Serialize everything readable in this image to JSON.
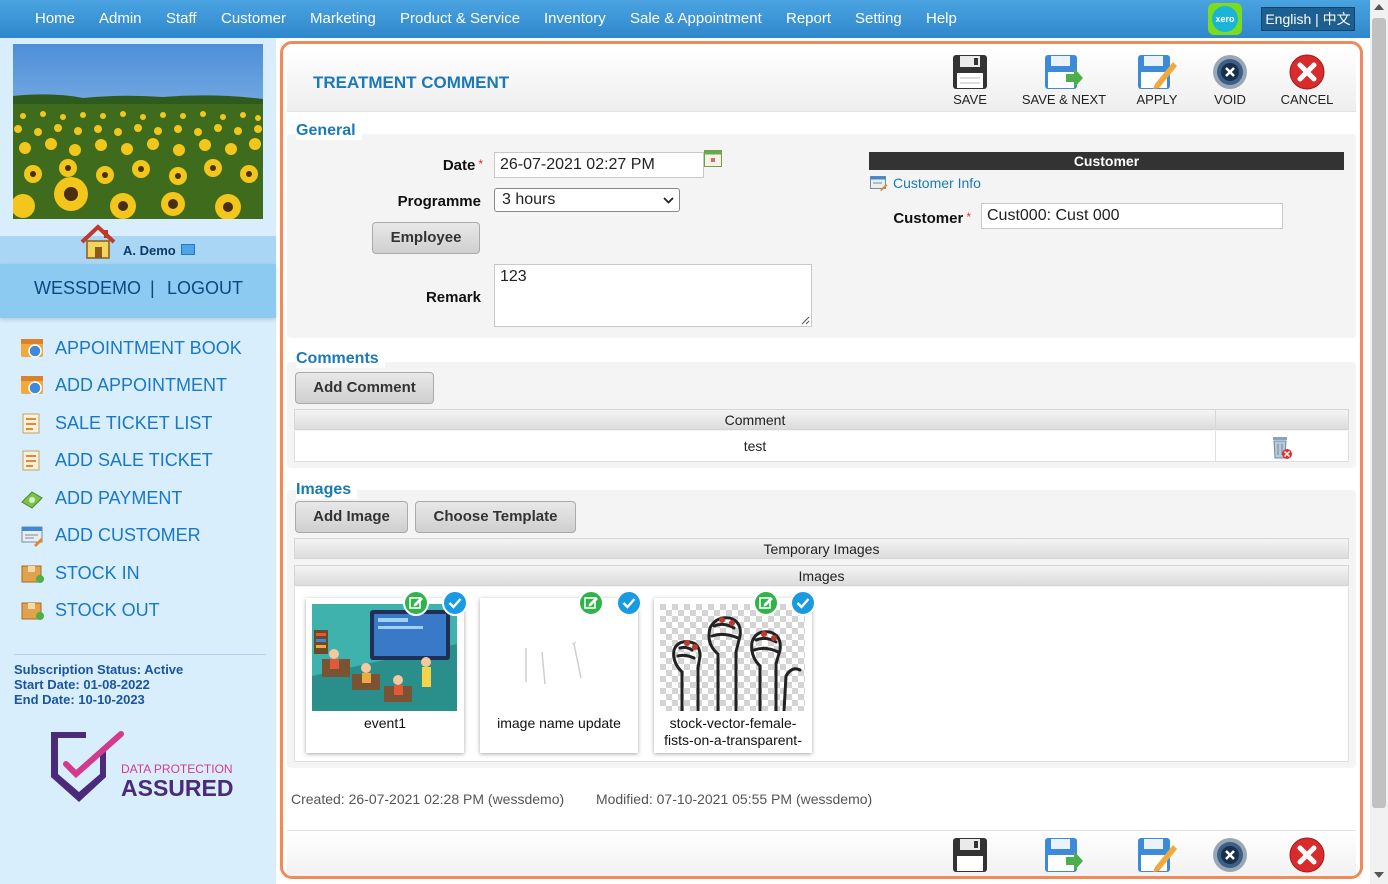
{
  "nav": {
    "items": [
      "Home",
      "Admin",
      "Staff",
      "Customer",
      "Marketing",
      "Product & Service",
      "Inventory",
      "Sale & Appointment",
      "Report",
      "Setting",
      "Help"
    ],
    "xero_label": "xero",
    "language": "English | 中文"
  },
  "sidebar": {
    "user_name": "A. Demo",
    "account": "WESSDEMO",
    "separator": "|",
    "logout": "LOGOUT",
    "menu": [
      {
        "label": "APPOINTMENT BOOK",
        "icon": "appointment-book-icon"
      },
      {
        "label": "ADD APPOINTMENT",
        "icon": "add-appointment-icon"
      },
      {
        "label": "SALE TICKET LIST",
        "icon": "sale-ticket-list-icon"
      },
      {
        "label": "ADD SALE TICKET",
        "icon": "add-sale-ticket-icon"
      },
      {
        "label": "ADD PAYMENT",
        "icon": "add-payment-icon"
      },
      {
        "label": "ADD CUSTOMER",
        "icon": "add-customer-icon"
      },
      {
        "label": "STOCK IN",
        "icon": "stock-in-icon"
      },
      {
        "label": "STOCK OUT",
        "icon": "stock-out-icon"
      }
    ],
    "subscription_status": "Subscription Status: Active",
    "start_date": "Start Date: 01-08-2022",
    "end_date": "End Date: 10-10-2023",
    "badge_line1": "DATA PROTECTION",
    "badge_line2": "ASSURED"
  },
  "form": {
    "title": "TREATMENT COMMENT",
    "toolbar": {
      "save": "SAVE",
      "save_next": "SAVE & NEXT",
      "apply": "APPLY",
      "void": "VOID",
      "cancel": "CANCEL"
    },
    "general": {
      "title": "General",
      "date_label": "Date",
      "required_mark": "*",
      "date_value": "26-07-2021 02:27 PM",
      "programme_label": "Programme",
      "programme_value": "3 hours",
      "employee_button": "Employee",
      "remark_label": "Remark",
      "remark_value": "123"
    },
    "customer": {
      "header": "Customer",
      "info_link": "Customer Info",
      "label": "Customer",
      "value": "Cust000: Cust 000"
    },
    "comments": {
      "title": "Comments",
      "add_button": "Add Comment",
      "column": "Comment",
      "rows": [
        "test"
      ]
    },
    "images": {
      "title": "Images",
      "add_button": "Add Image",
      "template_button": "Choose Template",
      "temp_header": "Temporary Images",
      "images_header": "Images",
      "items": [
        {
          "caption": "event1"
        },
        {
          "caption": "image name update"
        },
        {
          "caption": "stock-vector-female-fists-on-a-transparent-background"
        }
      ]
    },
    "meta": {
      "created": "Created: 26-07-2021 02:28 PM (wessdemo)",
      "modified": "Modified: 07-10-2021 05:55 PM (wessdemo)"
    }
  },
  "colors": {
    "nav_bg": "#2f87cc",
    "sidebar_bg": "#d9eefc",
    "accent_blue": "#1a7ab8",
    "main_border": "#f08a5a",
    "required": "#e03030"
  }
}
